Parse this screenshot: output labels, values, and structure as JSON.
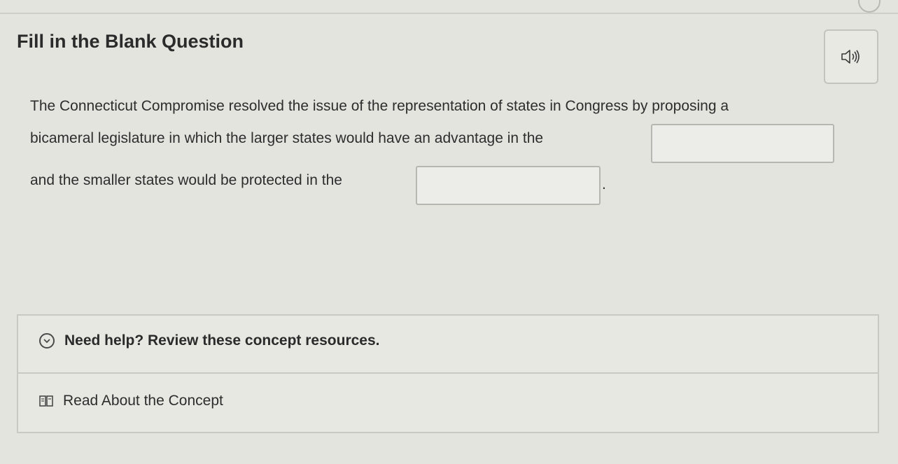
{
  "question": {
    "title": "Fill in the Blank Question",
    "audio_icon": "speaker-icon",
    "text_line_1": "The Connecticut Compromise resolved the issue of the representation of states in Congress by proposing a",
    "text_line_2": "bicameral legislature in which the larger states would have an advantage in the",
    "text_line_3": "and the smaller states would be protected in the",
    "period": ".",
    "blank_1_value": "",
    "blank_2_value": ""
  },
  "help": {
    "toggle_label": "Need help? Review these concept resources.",
    "toggle_icon": "chevron-down-circle-icon",
    "resource_label": "Read About the Concept",
    "resource_icon": "book-icon"
  }
}
